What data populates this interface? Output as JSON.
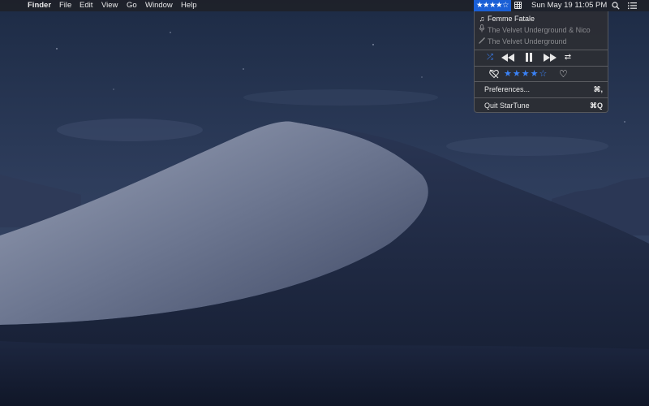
{
  "menubar": {
    "apple_glyph": "",
    "app_name": "Finder",
    "menus": [
      "File",
      "Edit",
      "View",
      "Go",
      "Window",
      "Help"
    ],
    "status_rating": "★★★★☆",
    "clock": "Sun May 19  11:05 PM"
  },
  "icons": {
    "apple": "apple-icon",
    "status_grid": "grid-icon",
    "search": "search-icon",
    "list": "list-icon",
    "note": "music-note-icon",
    "artist": "microphone-icon",
    "album": "album-pen-icon",
    "shuffle": "shuffle-icon",
    "previous": "previous-icon",
    "pause": "pause-icon",
    "next": "next-icon",
    "repeat": "repeat-icon",
    "dislike": "dislike-heart-icon",
    "love": "heart-icon"
  },
  "dropdown": {
    "track": "Femme Fatale",
    "artist": "The Velvet Underground & Nico",
    "album": "The Velvet Underground",
    "rating_stars": "★★★★☆",
    "rating_value": 4,
    "rating_max": 5,
    "preferences_label": "Preferences...",
    "preferences_shortcut": "⌘,",
    "quit_label": "Quit StarTune",
    "quit_shortcut": "⌘Q"
  },
  "colors": {
    "accent": "#3b82f6",
    "status_highlight": "#1a5fd6",
    "menubar_bg": "#1e2026",
    "menu_bg": "#2c2e34"
  }
}
